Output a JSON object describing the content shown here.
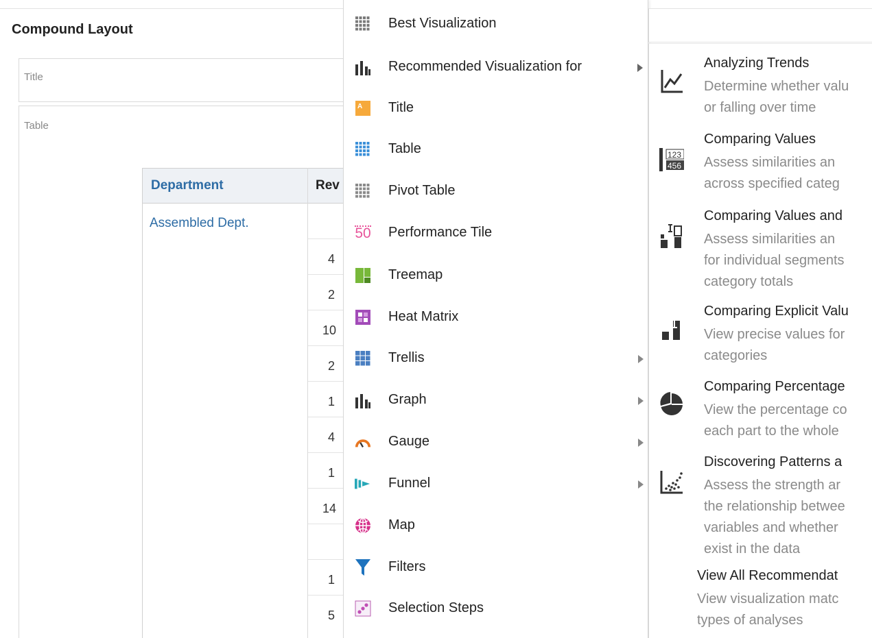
{
  "page": {
    "compound_title": "Compound Layout",
    "title_view_label": "Title",
    "table_view_label": "Table"
  },
  "table": {
    "headers": [
      "Department",
      "Rev"
    ],
    "department_value": "Assembled Dept.",
    "revenue_fragments": [
      "4",
      "2",
      "10",
      "2",
      "1",
      "4",
      "1",
      "14",
      "",
      "1",
      "5"
    ]
  },
  "menu": {
    "items": [
      {
        "label": "Best Visualization",
        "icon": "grid-icon",
        "submenu": false
      },
      {
        "label": "Recommended Visualization for",
        "icon": "bar-chart-icon",
        "submenu": true
      },
      {
        "label": "Title",
        "icon": "title-icon",
        "submenu": false
      },
      {
        "label": "Table",
        "icon": "table-icon",
        "submenu": false
      },
      {
        "label": "Pivot Table",
        "icon": "pivot-table-icon",
        "submenu": false
      },
      {
        "label": "Performance Tile",
        "icon": "performance-tile-icon",
        "submenu": false
      },
      {
        "label": "Treemap",
        "icon": "treemap-icon",
        "submenu": false
      },
      {
        "label": "Heat Matrix",
        "icon": "heat-matrix-icon",
        "submenu": false
      },
      {
        "label": "Trellis",
        "icon": "trellis-icon",
        "submenu": true
      },
      {
        "label": "Graph",
        "icon": "graph-icon",
        "submenu": true
      },
      {
        "label": "Gauge",
        "icon": "gauge-icon",
        "submenu": true
      },
      {
        "label": "Funnel",
        "icon": "funnel-icon",
        "submenu": true
      },
      {
        "label": "Map",
        "icon": "map-icon",
        "submenu": false
      },
      {
        "label": "Filters",
        "icon": "filter-icon",
        "submenu": false
      },
      {
        "label": "Selection Steps",
        "icon": "selection-steps-icon",
        "submenu": false
      }
    ],
    "performance_tile_glyph": "50"
  },
  "submenu": {
    "items": [
      {
        "title": "Analyzing Trends",
        "desc": "Determine whether valu\nor falling over time",
        "icon": "trend-icon"
      },
      {
        "title": "Comparing Values",
        "desc": "Assess similarities an\nacross specified categ",
        "icon": "compare-values-icon",
        "icon_text_top": "123",
        "icon_text_bottom": "456"
      },
      {
        "title": "Comparing Values and",
        "desc": "Assess similarities an\nfor individual segments\ncategory totals",
        "icon": "compare-segments-icon"
      },
      {
        "title": "Comparing Explicit Valu",
        "desc": "View precise values for\ncategories",
        "icon": "explicit-values-icon"
      },
      {
        "title": "Comparing Percentage",
        "desc": "View the percentage co\neach part to the whole",
        "icon": "pie-icon"
      },
      {
        "title": "Discovering Patterns a",
        "desc": "Assess the strength ar\nthe relationship betwee\nvariables and whether\nexist in the data",
        "icon": "scatter-icon"
      },
      {
        "title": "View All Recommendat",
        "desc": "View visualization matc\ntypes of analyses",
        "icon": ""
      }
    ]
  },
  "colors": {
    "link_blue": "#2d6ca5",
    "title_orange": "#f6a93b",
    "table_blue": "#3a8fd8",
    "perf_pink": "#e8559b",
    "treemap_green": "#78b83a",
    "heat_purple": "#a24bb8",
    "gauge_orange": "#e87722",
    "funnel_teal": "#27a8b8",
    "map_magenta": "#d6308a",
    "filter_blue": "#1e73be"
  }
}
